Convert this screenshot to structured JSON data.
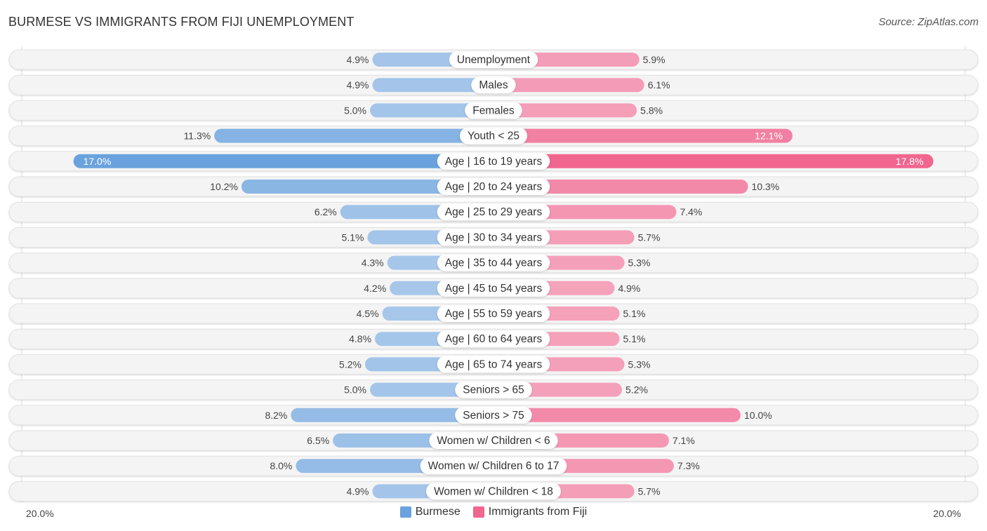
{
  "header": {
    "title": "BURMESE VS IMMIGRANTS FROM FIJI UNEMPLOYMENT",
    "source": "Source: ZipAtlas.com"
  },
  "colors": {
    "burmese": "#6aa2dd",
    "burmese_light": "#a8c8ea",
    "fiji": "#f0668f",
    "fiji_light": "#f5a6be",
    "row_bg": "#f3f3f3"
  },
  "legend": [
    {
      "name": "Burmese",
      "color": "#6aa2dd"
    },
    {
      "name": "Immigrants from Fiji",
      "color": "#f0668f"
    }
  ],
  "axis": {
    "left_label": "20.0%",
    "right_label": "20.0%"
  },
  "chart_data": {
    "type": "bar",
    "orientation": "horizontal-diverging",
    "title": "BURMESE VS IMMIGRANTS FROM FIJI UNEMPLOYMENT",
    "xlim": [
      -20,
      20
    ],
    "categories": [
      "Unemployment",
      "Males",
      "Females",
      "Youth < 25",
      "Age | 16 to 19 years",
      "Age | 20 to 24 years",
      "Age | 25 to 29 years",
      "Age | 30 to 34 years",
      "Age | 35 to 44 years",
      "Age | 45 to 54 years",
      "Age | 55 to 59 years",
      "Age | 60 to 64 years",
      "Age | 65 to 74 years",
      "Seniors > 65",
      "Seniors > 75",
      "Women w/ Children < 6",
      "Women w/ Children 6 to 17",
      "Women w/ Children < 18"
    ],
    "series": [
      {
        "name": "Burmese",
        "values": [
          4.9,
          4.9,
          5.0,
          11.3,
          17.0,
          10.2,
          6.2,
          5.1,
          4.3,
          4.2,
          4.5,
          4.8,
          5.2,
          5.0,
          8.2,
          6.5,
          8.0,
          4.9
        ]
      },
      {
        "name": "Immigrants from Fiji",
        "values": [
          5.9,
          6.1,
          5.8,
          12.1,
          17.8,
          10.3,
          7.4,
          5.7,
          5.3,
          4.9,
          5.1,
          5.1,
          5.3,
          5.2,
          10.0,
          7.1,
          7.3,
          5.7
        ]
      }
    ],
    "labels_left": [
      "4.9%",
      "4.9%",
      "5.0%",
      "11.3%",
      "17.0%",
      "10.2%",
      "6.2%",
      "5.1%",
      "4.3%",
      "4.2%",
      "4.5%",
      "4.8%",
      "5.2%",
      "5.0%",
      "8.2%",
      "6.5%",
      "8.0%",
      "4.9%"
    ],
    "labels_right": [
      "5.9%",
      "6.1%",
      "5.8%",
      "12.1%",
      "17.8%",
      "10.3%",
      "7.4%",
      "5.7%",
      "5.3%",
      "4.9%",
      "5.1%",
      "5.1%",
      "5.3%",
      "5.2%",
      "10.0%",
      "7.1%",
      "7.3%",
      "5.7%"
    ],
    "legend_position": "bottom-center",
    "grid": false
  }
}
